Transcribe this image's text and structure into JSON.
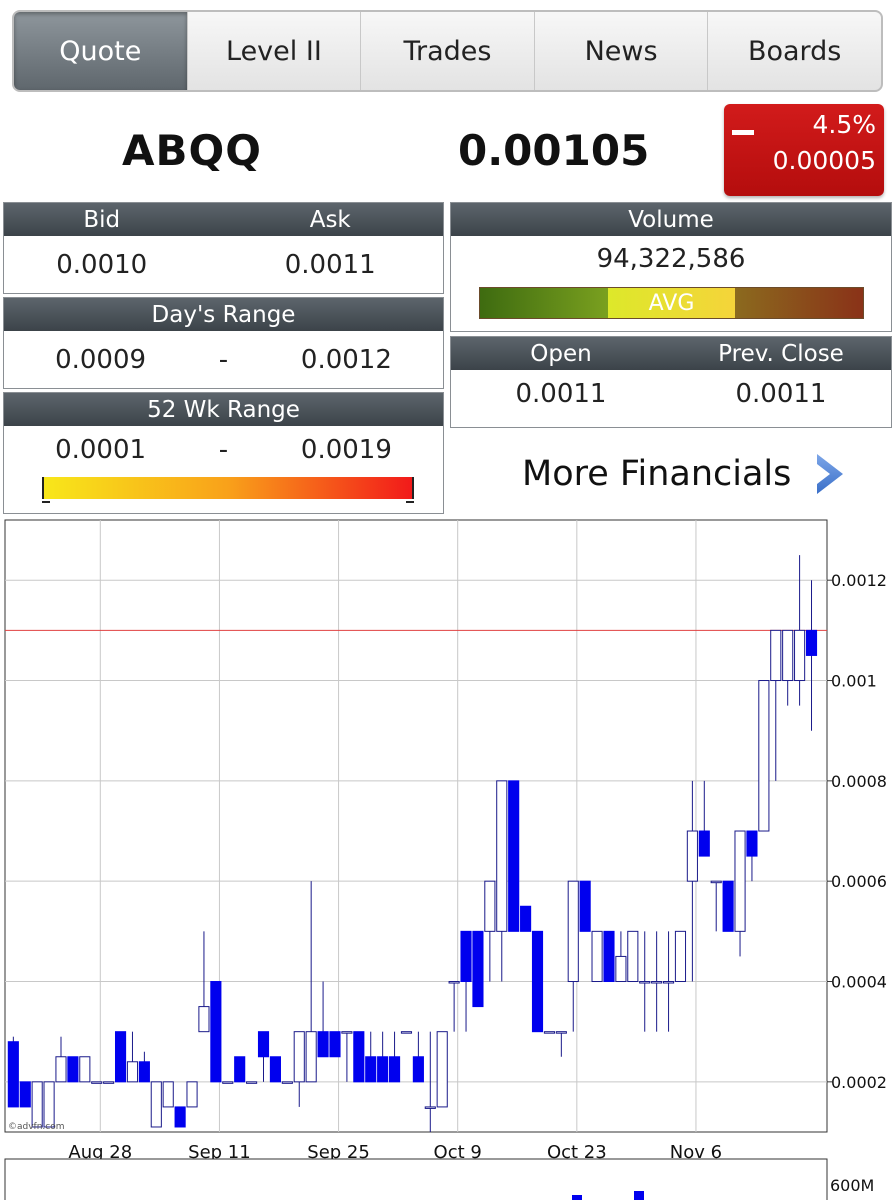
{
  "tabs": [
    {
      "label": "Quote",
      "active": true
    },
    {
      "label": "Level II"
    },
    {
      "label": "Trades"
    },
    {
      "label": "News"
    },
    {
      "label": "Boards"
    }
  ],
  "quote": {
    "symbol": "ABQQ",
    "last": "0.00105",
    "change_pct": "4.5%",
    "change": "0.00005",
    "change_color": "#c4121a"
  },
  "bid_ask": {
    "bid_label": "Bid",
    "ask_label": "Ask",
    "bid": "0.0010",
    "ask": "0.0011"
  },
  "days_range": {
    "label": "Day's Range",
    "low": "0.0009",
    "sep": "-",
    "high": "0.0012"
  },
  "wk52_range": {
    "label": "52 Wk Range",
    "low": "0.0001",
    "sep": "-",
    "high": "0.0019"
  },
  "volume": {
    "label": "Volume",
    "value": "94,322,586",
    "bar_label": "AVG"
  },
  "open_close": {
    "open_label": "Open",
    "close_label": "Prev. Close",
    "open": "0.0011",
    "prev_close": "0.0011"
  },
  "more_financials": "More Financials",
  "watermark": "©advfn.com",
  "chart_data": {
    "type": "candlestick",
    "ylim": [
      0.0001,
      0.00132
    ],
    "y_ticks": [
      0.0002,
      0.0004,
      0.0006,
      0.0008,
      0.001,
      0.0012
    ],
    "y_tick_labels": [
      "0.0002",
      "0.0004",
      "0.0006",
      "0.0008",
      "0.001",
      "0.0012"
    ],
    "x_tick_labels": [
      "Aug 28",
      "Sep 11",
      "Sep 25",
      "Oct 9",
      "Oct 23",
      "Nov 6"
    ],
    "reference_line": 0.0011,
    "reference_color": "#e04040",
    "up_color": "#ffffff",
    "down_color": "#0000ee",
    "candles": [
      {
        "o": 0.00028,
        "h": 0.00029,
        "l": 0.00015,
        "c": 0.00015
      },
      {
        "o": 0.0002,
        "h": 0.0002,
        "l": 0.00015,
        "c": 0.00015
      },
      {
        "o": 0.00011,
        "h": 0.0002,
        "l": 0.00011,
        "c": 0.0002
      },
      {
        "o": 0.00011,
        "h": 0.0002,
        "l": 0.00011,
        "c": 0.0002
      },
      {
        "o": 0.0002,
        "h": 0.00029,
        "l": 0.0002,
        "c": 0.00025
      },
      {
        "o": 0.00025,
        "h": 0.00025,
        "l": 0.0002,
        "c": 0.0002
      },
      {
        "o": 0.0002,
        "h": 0.00025,
        "l": 0.0002,
        "c": 0.00025
      },
      {
        "o": 0.0002,
        "h": 0.0002,
        "l": 0.0002,
        "c": 0.0002
      },
      {
        "o": 0.0002,
        "h": 0.0002,
        "l": 0.0002,
        "c": 0.0002
      },
      {
        "o": 0.0003,
        "h": 0.0003,
        "l": 0.0002,
        "c": 0.0002
      },
      {
        "o": 0.0002,
        "h": 0.0003,
        "l": 0.0002,
        "c": 0.00024
      },
      {
        "o": 0.00024,
        "h": 0.00026,
        "l": 0.0002,
        "c": 0.0002
      },
      {
        "o": 0.00011,
        "h": 0.0002,
        "l": 0.00011,
        "c": 0.0002
      },
      {
        "o": 0.00015,
        "h": 0.0002,
        "l": 0.00015,
        "c": 0.0002
      },
      {
        "o": 0.00015,
        "h": 0.00015,
        "l": 0.00011,
        "c": 0.00011
      },
      {
        "o": 0.00015,
        "h": 0.0002,
        "l": 0.00015,
        "c": 0.0002
      },
      {
        "o": 0.0003,
        "h": 0.0005,
        "l": 0.0003,
        "c": 0.00035
      },
      {
        "o": 0.0004,
        "h": 0.0004,
        "l": 0.0002,
        "c": 0.0002
      },
      {
        "o": 0.0002,
        "h": 0.0002,
        "l": 0.0002,
        "c": 0.0002
      },
      {
        "o": 0.00025,
        "h": 0.00025,
        "l": 0.0002,
        "c": 0.0002
      },
      {
        "o": 0.0002,
        "h": 0.0002,
        "l": 0.0002,
        "c": 0.0002
      },
      {
        "o": 0.0003,
        "h": 0.0003,
        "l": 0.0002,
        "c": 0.00025
      },
      {
        "o": 0.00025,
        "h": 0.00025,
        "l": 0.0002,
        "c": 0.0002
      },
      {
        "o": 0.0002,
        "h": 0.0002,
        "l": 0.0002,
        "c": 0.0002
      },
      {
        "o": 0.0002,
        "h": 0.0003,
        "l": 0.00015,
        "c": 0.0003
      },
      {
        "o": 0.0002,
        "h": 0.0006,
        "l": 0.0002,
        "c": 0.0003
      },
      {
        "o": 0.0003,
        "h": 0.0004,
        "l": 0.0003,
        "c": 0.00025
      },
      {
        "o": 0.0003,
        "h": 0.0003,
        "l": 0.0003,
        "c": 0.00025
      },
      {
        "o": 0.0003,
        "h": 0.0003,
        "l": 0.0002,
        "c": 0.0003
      },
      {
        "o": 0.0003,
        "h": 0.0003,
        "l": 0.0002,
        "c": 0.0002
      },
      {
        "o": 0.00025,
        "h": 0.0003,
        "l": 0.0002,
        "c": 0.0002
      },
      {
        "o": 0.00025,
        "h": 0.0003,
        "l": 0.0002,
        "c": 0.0002
      },
      {
        "o": 0.00025,
        "h": 0.0003,
        "l": 0.0002,
        "c": 0.0002
      },
      {
        "o": 0.0003,
        "h": 0.0003,
        "l": 0.0003,
        "c": 0.0003
      },
      {
        "o": 0.00025,
        "h": 0.0003,
        "l": 0.0002,
        "c": 0.0002
      },
      {
        "o": 0.00015,
        "h": 0.0003,
        "l": 0.0001,
        "c": 0.00015
      },
      {
        "o": 0.00015,
        "h": 0.0003,
        "l": 0.00015,
        "c": 0.0003
      },
      {
        "o": 0.0004,
        "h": 0.0004,
        "l": 0.0003,
        "c": 0.0004
      },
      {
        "o": 0.0005,
        "h": 0.0005,
        "l": 0.0003,
        "c": 0.0004
      },
      {
        "o": 0.0005,
        "h": 0.0005,
        "l": 0.00035,
        "c": 0.00035
      },
      {
        "o": 0.0005,
        "h": 0.0006,
        "l": 0.0004,
        "c": 0.0006
      },
      {
        "o": 0.0005,
        "h": 0.0008,
        "l": 0.0004,
        "c": 0.0008
      },
      {
        "o": 0.0008,
        "h": 0.0008,
        "l": 0.0005,
        "c": 0.0005
      },
      {
        "o": 0.00055,
        "h": 0.00055,
        "l": 0.0005,
        "c": 0.0005
      },
      {
        "o": 0.0005,
        "h": 0.0005,
        "l": 0.0003,
        "c": 0.0003
      },
      {
        "o": 0.0003,
        "h": 0.0003,
        "l": 0.0003,
        "c": 0.0003
      },
      {
        "o": 0.0003,
        "h": 0.0003,
        "l": 0.00025,
        "c": 0.0003
      },
      {
        "o": 0.0004,
        "h": 0.0006,
        "l": 0.0003,
        "c": 0.0006
      },
      {
        "o": 0.0006,
        "h": 0.0006,
        "l": 0.0005,
        "c": 0.0005
      },
      {
        "o": 0.0004,
        "h": 0.0005,
        "l": 0.0004,
        "c": 0.0005
      },
      {
        "o": 0.0005,
        "h": 0.0005,
        "l": 0.0004,
        "c": 0.0004
      },
      {
        "o": 0.0004,
        "h": 0.0005,
        "l": 0.0004,
        "c": 0.00045
      },
      {
        "o": 0.0004,
        "h": 0.0005,
        "l": 0.0004,
        "c": 0.0005
      },
      {
        "o": 0.0004,
        "h": 0.0005,
        "l": 0.0003,
        "c": 0.0004
      },
      {
        "o": 0.0004,
        "h": 0.0005,
        "l": 0.0003,
        "c": 0.0004
      },
      {
        "o": 0.0004,
        "h": 0.0005,
        "l": 0.0003,
        "c": 0.0004
      },
      {
        "o": 0.0004,
        "h": 0.0005,
        "l": 0.0004,
        "c": 0.0005
      },
      {
        "o": 0.0006,
        "h": 0.0008,
        "l": 0.0004,
        "c": 0.0007
      },
      {
        "o": 0.0007,
        "h": 0.0008,
        "l": 0.00065,
        "c": 0.00065
      },
      {
        "o": 0.0006,
        "h": 0.0006,
        "l": 0.0005,
        "c": 0.0006
      },
      {
        "o": 0.0006,
        "h": 0.0006,
        "l": 0.0005,
        "c": 0.0005
      },
      {
        "o": 0.0005,
        "h": 0.0007,
        "l": 0.00045,
        "c": 0.0007
      },
      {
        "o": 0.0007,
        "h": 0.0007,
        "l": 0.0006,
        "c": 0.00065
      },
      {
        "o": 0.0007,
        "h": 0.0008,
        "l": 0.0007,
        "c": 0.001
      },
      {
        "o": 0.001,
        "h": 0.0011,
        "l": 0.0008,
        "c": 0.0011
      },
      {
        "o": 0.001,
        "h": 0.0011,
        "l": 0.00095,
        "c": 0.0011
      },
      {
        "o": 0.001,
        "h": 0.00125,
        "l": 0.00095,
        "c": 0.0011
      },
      {
        "o": 0.0011,
        "h": 0.0012,
        "l": 0.0009,
        "c": 0.00105
      }
    ]
  },
  "volume_chart": {
    "y_tick_label": "600M"
  }
}
